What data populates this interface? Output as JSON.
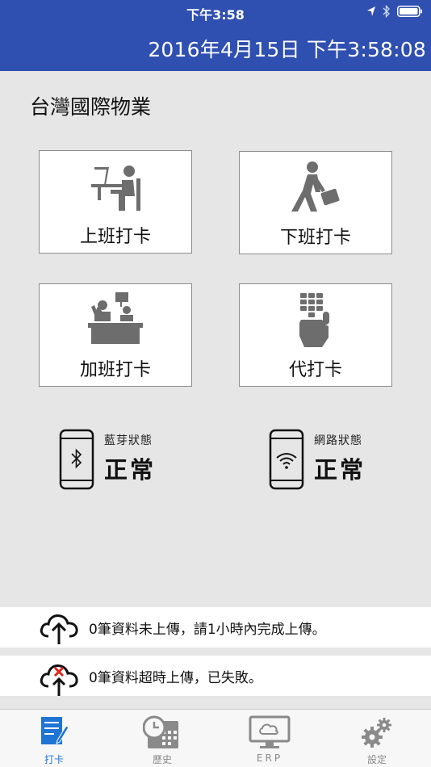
{
  "status_bar": {
    "time": "下午3:58"
  },
  "header": {
    "datetime": "2016年4月15日 下午3:58:08"
  },
  "company": {
    "name": "台灣國際物業"
  },
  "buttons": {
    "clock_in": "上班打卡",
    "clock_out": "下班打卡",
    "overtime": "加班打卡",
    "proxy": "代打卡"
  },
  "bluetooth": {
    "label": "藍芽狀態",
    "value": "正常"
  },
  "network": {
    "label": "網路狀態",
    "value": "正常"
  },
  "notices": {
    "pending": "0筆資料未上傳，請1小時內完成上傳。",
    "failed": "0筆資料超時上傳，已失敗。"
  },
  "tabs": [
    {
      "label": "打卡"
    },
    {
      "label": "歷史"
    },
    {
      "label": "ERP"
    },
    {
      "label": "設定"
    }
  ],
  "colors": {
    "header": "#2f4fb1",
    "active_tab": "#1f74d6",
    "alert": "#d9261c"
  }
}
